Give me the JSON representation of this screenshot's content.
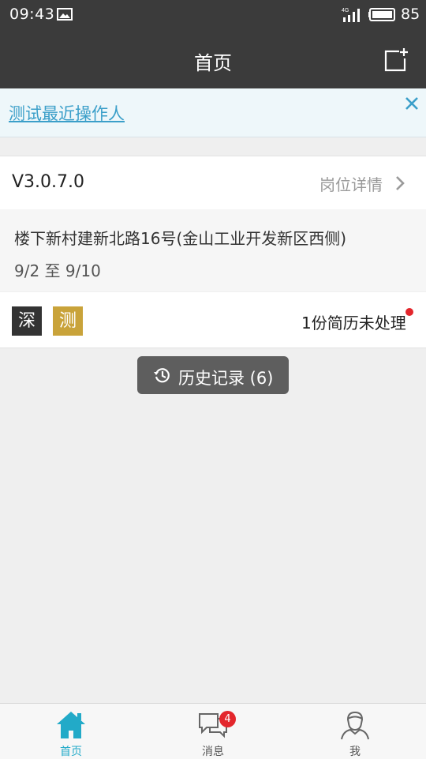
{
  "status_bar": {
    "time": "09:43",
    "network": "4G",
    "battery": "85",
    "icons": [
      "image-icon",
      "signal-icon",
      "battery-icon"
    ]
  },
  "app_bar": {
    "title": "首页",
    "action_icon": "new-note-icon"
  },
  "notice": {
    "link_text": "测试最近操作人",
    "close_icon": "close-icon"
  },
  "job_card": {
    "version": "V3.0.7.0",
    "detail_label": "岗位详情",
    "address": "楼下新村建新北路16号(金山工业开发新区西侧)",
    "dates": "9/2 至 9/10",
    "badges": [
      "深",
      "测"
    ],
    "resume_status": "1份简历未处理"
  },
  "history_button": {
    "label": "历史记录 (6)",
    "icon": "history-icon"
  },
  "bottom_nav": {
    "items": [
      {
        "label": "首页",
        "icon": "home-icon",
        "active": true
      },
      {
        "label": "消息",
        "icon": "chat-icon",
        "badge": "4"
      },
      {
        "label": "我",
        "icon": "user-icon"
      }
    ]
  },
  "colors": {
    "bar_bg": "#3b3b3b",
    "accent": "#22aac8",
    "link": "#3b9fc9",
    "badge_red": "#e3262c",
    "badge_gold": "#c9a33a"
  }
}
